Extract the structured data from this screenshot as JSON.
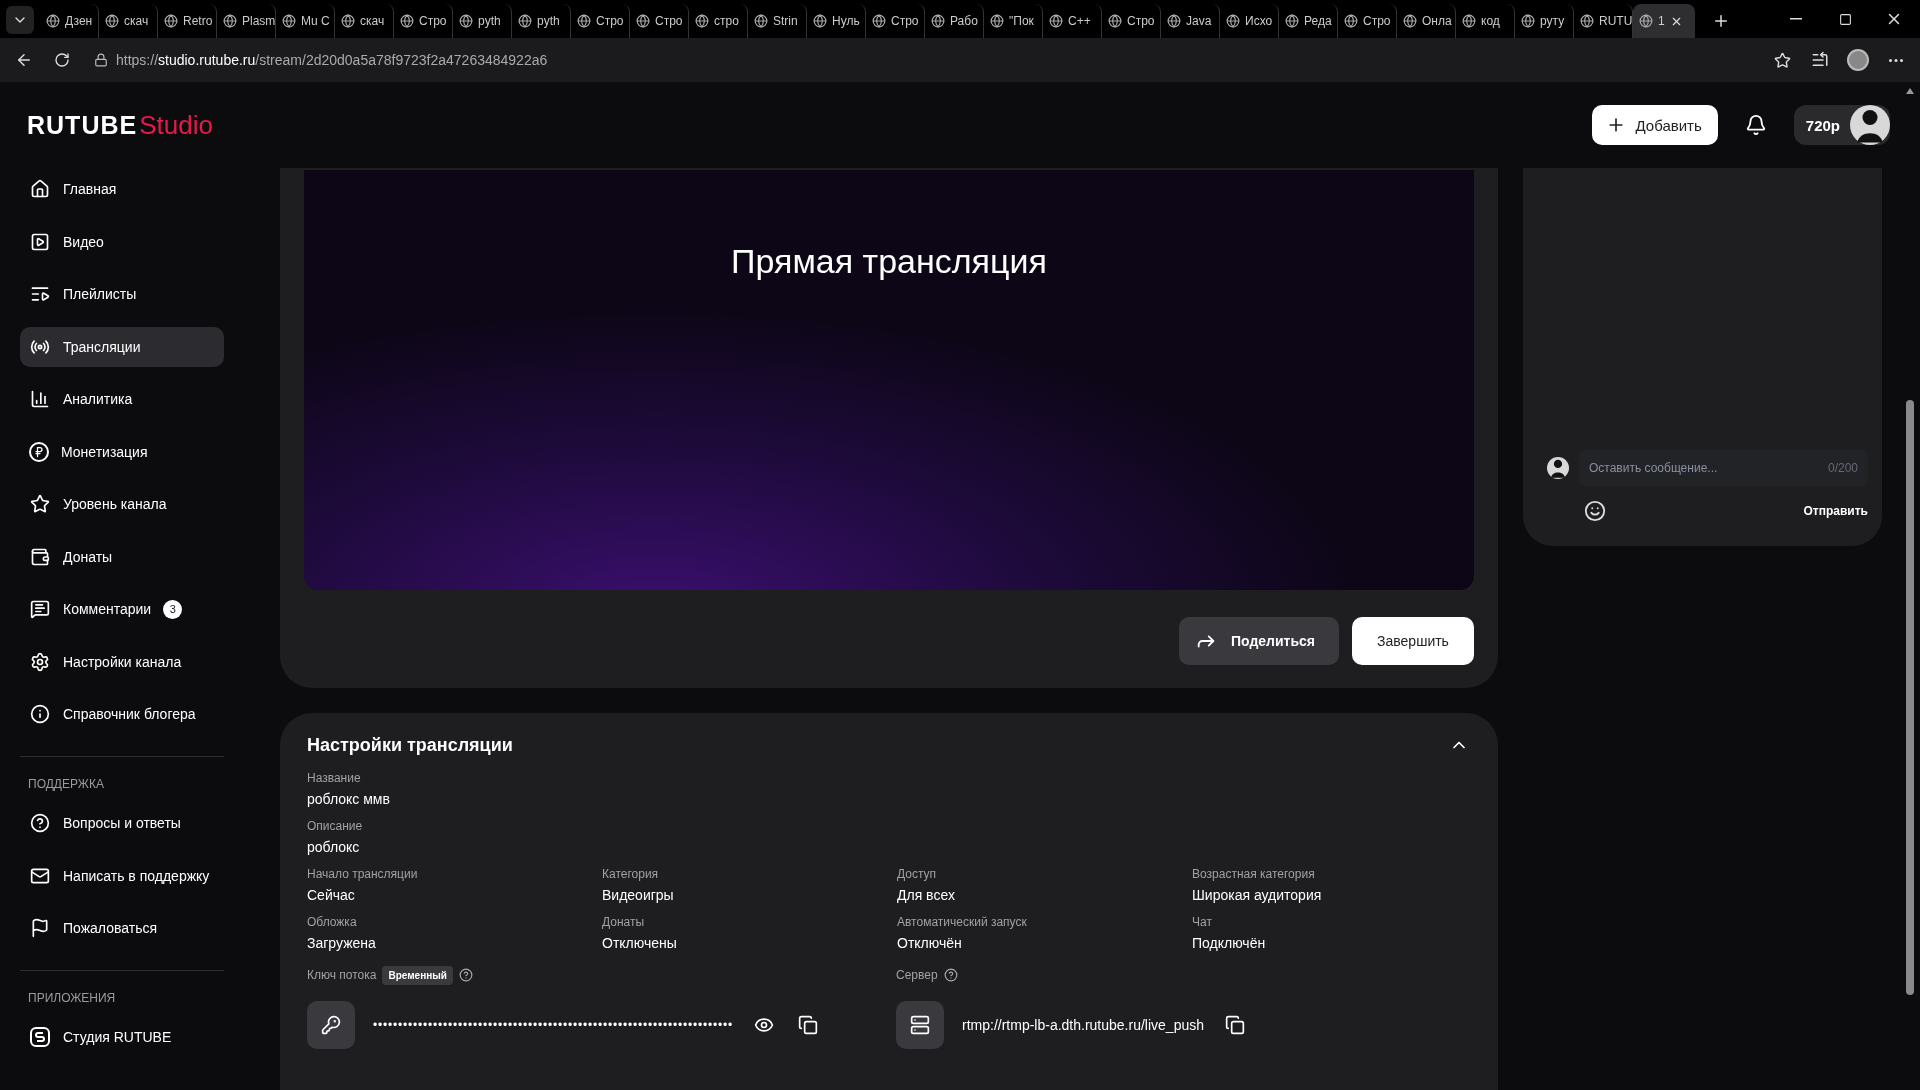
{
  "browser": {
    "tabs": [
      {
        "title": "Дзен",
        "selected": false
      },
      {
        "title": "скач",
        "selected": false
      },
      {
        "title": "Retro",
        "selected": false
      },
      {
        "title": "Plasm",
        "selected": false
      },
      {
        "title": "Mu C",
        "selected": false
      },
      {
        "title": "скач",
        "selected": false
      },
      {
        "title": "Стро",
        "selected": false
      },
      {
        "title": "pyth",
        "selected": false
      },
      {
        "title": "pyth",
        "selected": false
      },
      {
        "title": "Стро",
        "selected": false
      },
      {
        "title": "Стро",
        "selected": false
      },
      {
        "title": "стро",
        "selected": false
      },
      {
        "title": "Strin",
        "selected": false
      },
      {
        "title": "Нуль",
        "selected": false
      },
      {
        "title": "Стро",
        "selected": false
      },
      {
        "title": "Рабо",
        "selected": false
      },
      {
        "title": "\"Пок",
        "selected": false
      },
      {
        "title": "C++",
        "selected": false
      },
      {
        "title": "Стро",
        "selected": false
      },
      {
        "title": "Java",
        "selected": false
      },
      {
        "title": "Исхо",
        "selected": false
      },
      {
        "title": "Реда",
        "selected": false
      },
      {
        "title": "Стро",
        "selected": false
      },
      {
        "title": "Онла",
        "selected": false
      },
      {
        "title": "код",
        "selected": false
      },
      {
        "title": "руту",
        "selected": false
      },
      {
        "title": "RUTU",
        "selected": false
      },
      {
        "title": "1",
        "selected": true
      }
    ],
    "url": {
      "scheme": "https://",
      "host": "studio.rutube.ru",
      "path": "/stream/2d20d0a5a78f9723f2a47263484922a6"
    }
  },
  "header": {
    "logo": {
      "brand": "RUTUBE",
      "product": "Studio"
    },
    "add_button": "Добавить",
    "quality": "720p"
  },
  "sidebar": {
    "sections": [
      {
        "items": [
          {
            "label": "Главная",
            "selected": false
          },
          {
            "label": "Видео",
            "selected": false
          },
          {
            "label": "Плейлисты",
            "selected": false
          },
          {
            "label": "Трансляции",
            "selected": true
          },
          {
            "label": "Аналитика",
            "selected": false
          },
          {
            "label": "Монетизация",
            "selected": false
          },
          {
            "label": "Уровень канала",
            "selected": false
          },
          {
            "label": "Донаты",
            "selected": false
          },
          {
            "label": "Комментарии",
            "selected": false,
            "badge": "3"
          },
          {
            "label": "Настройки канала",
            "selected": false
          },
          {
            "label": "Справочник блогера",
            "selected": false
          }
        ]
      },
      {
        "heading": "ПОДДЕРЖКА",
        "items": [
          {
            "label": "Вопросы и ответы",
            "selected": false
          },
          {
            "label": "Написать в поддержку",
            "selected": false
          },
          {
            "label": "Пожаловаться",
            "selected": false
          }
        ]
      },
      {
        "heading": "ПРИЛОЖЕНИЯ",
        "items": [
          {
            "label": "Студия RUTUBE",
            "selected": false
          }
        ]
      }
    ]
  },
  "stream": {
    "title": "Прямая трансляция",
    "share_button": "Поделиться",
    "finish_button": "Завершить"
  },
  "chat": {
    "placeholder": "Оставить сообщение...",
    "counter": "0/200",
    "send_button": "Отправить"
  },
  "settings": {
    "title": "Настройки трансляции",
    "expanded": true,
    "fields": [
      {
        "label": "Название",
        "value": "роблокс ммв"
      },
      {
        "label": "Описание",
        "value": "роблокс"
      }
    ],
    "grid": [
      {
        "label": "Начало трансляции",
        "value": "Сейчас"
      },
      {
        "label": "Категория",
        "value": "Видеоигры"
      },
      {
        "label": "Доступ",
        "value": "Для всех"
      },
      {
        "label": "Возрастная категория",
        "value": "Широкая аудитория"
      },
      {
        "label": "Обложка",
        "value": "Загружена"
      },
      {
        "label": "Донаты",
        "value": "Отключены"
      },
      {
        "label": "Автоматический запуск",
        "value": "Отключён"
      },
      {
        "label": "Чат",
        "value": "Подключён"
      }
    ],
    "stream_key": {
      "label": "Ключ потока",
      "badge": "Временный",
      "value": "••••••••••••••••••••••••••••••••••••••••••••••••••••••••••••••••••••••••"
    },
    "server": {
      "label": "Сервер",
      "value": "rtmp://rtmp-lb-a.dth.rutube.ru/live_push"
    }
  }
}
